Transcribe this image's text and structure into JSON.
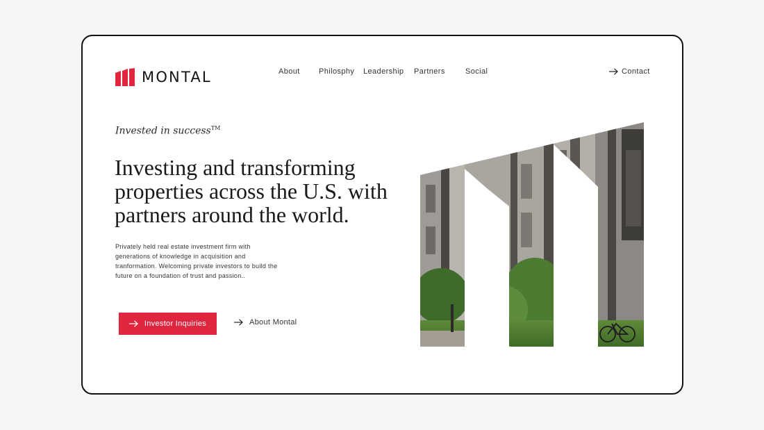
{
  "brand": {
    "name": "MONTAL",
    "accent_color": "#e0263f",
    "logo_icon": "montal-m-logo-icon"
  },
  "nav": {
    "items": [
      {
        "label": "About"
      },
      {
        "label": "Philosphy"
      },
      {
        "label": "Leadership"
      },
      {
        "label": "Partners"
      },
      {
        "label": "Social"
      }
    ],
    "contact_label": "Contact",
    "contact_icon": "arrow-right-icon"
  },
  "hero": {
    "tagline": "Invested in success",
    "tagline_mark": "TM",
    "headline": "Investing and transforming properties across the U.S. with partners around the world.",
    "body": "Privately held real estate investment firm with generations of knowledge in acquisition and tranformation. Welcoming private investors to build the future on a foundation of trust and passion..",
    "primary_button": "Investor Inquiries",
    "secondary_button": "About Montal",
    "image": "building-photo-m-shape"
  }
}
